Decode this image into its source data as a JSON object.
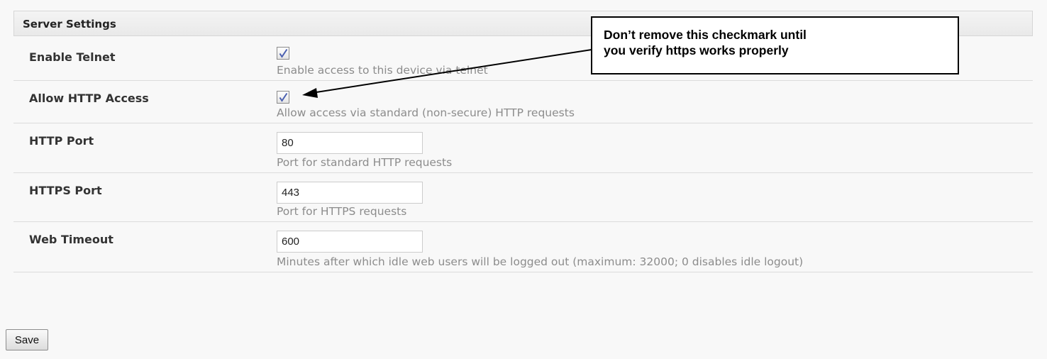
{
  "section": {
    "title": "Server Settings"
  },
  "rows": {
    "enable_telnet": {
      "label": "Enable Telnet",
      "checked": true,
      "description": "Enable access to this device via telnet"
    },
    "allow_http": {
      "label": "Allow HTTP Access",
      "checked": true,
      "description": "Allow access via standard (non-secure) HTTP requests"
    },
    "http_port": {
      "label": "HTTP Port",
      "value": "80",
      "description": "Port for standard HTTP requests"
    },
    "https_port": {
      "label": "HTTPS Port",
      "value": "443",
      "description": "Port for HTTPS requests"
    },
    "web_timeout": {
      "label": "Web Timeout",
      "value": "600",
      "description": "Minutes after which idle web users will be logged out (maximum: 32000; 0 disables idle logout)"
    }
  },
  "save_label": "Save",
  "callout": {
    "line1": "Don’t remove this checkmark until",
    "line2": "you verify https works properly"
  }
}
